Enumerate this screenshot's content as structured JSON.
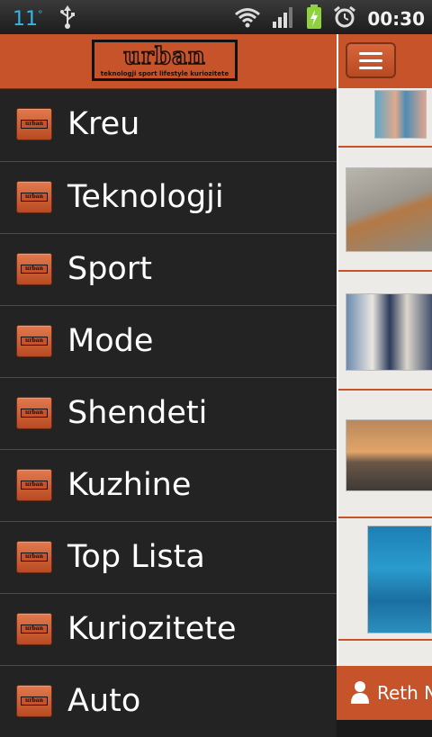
{
  "status_bar": {
    "temperature": "11",
    "degree": "°",
    "time": "00:30",
    "icons": [
      "usb-icon",
      "wifi-icon",
      "signal-icon",
      "battery-charging-icon",
      "alarm-icon"
    ]
  },
  "drawer": {
    "logo": {
      "word": "urban",
      "tagline": "teknologji sport lifestyle kuriozitete"
    },
    "items": [
      {
        "label": "Kreu"
      },
      {
        "label": "Teknologji"
      },
      {
        "label": "Sport"
      },
      {
        "label": "Mode"
      },
      {
        "label": "Shendeti"
      },
      {
        "label": "Kuzhine"
      },
      {
        "label": "Top Lista"
      },
      {
        "label": "Kuriozitete"
      },
      {
        "label": "Auto"
      }
    ]
  },
  "content": {
    "bottom_label": "Reth N"
  },
  "colors": {
    "accent": "#c7532a",
    "drawer_bg": "#232323",
    "content_bg": "#ecebe7",
    "temp_blue": "#35b6e8"
  }
}
